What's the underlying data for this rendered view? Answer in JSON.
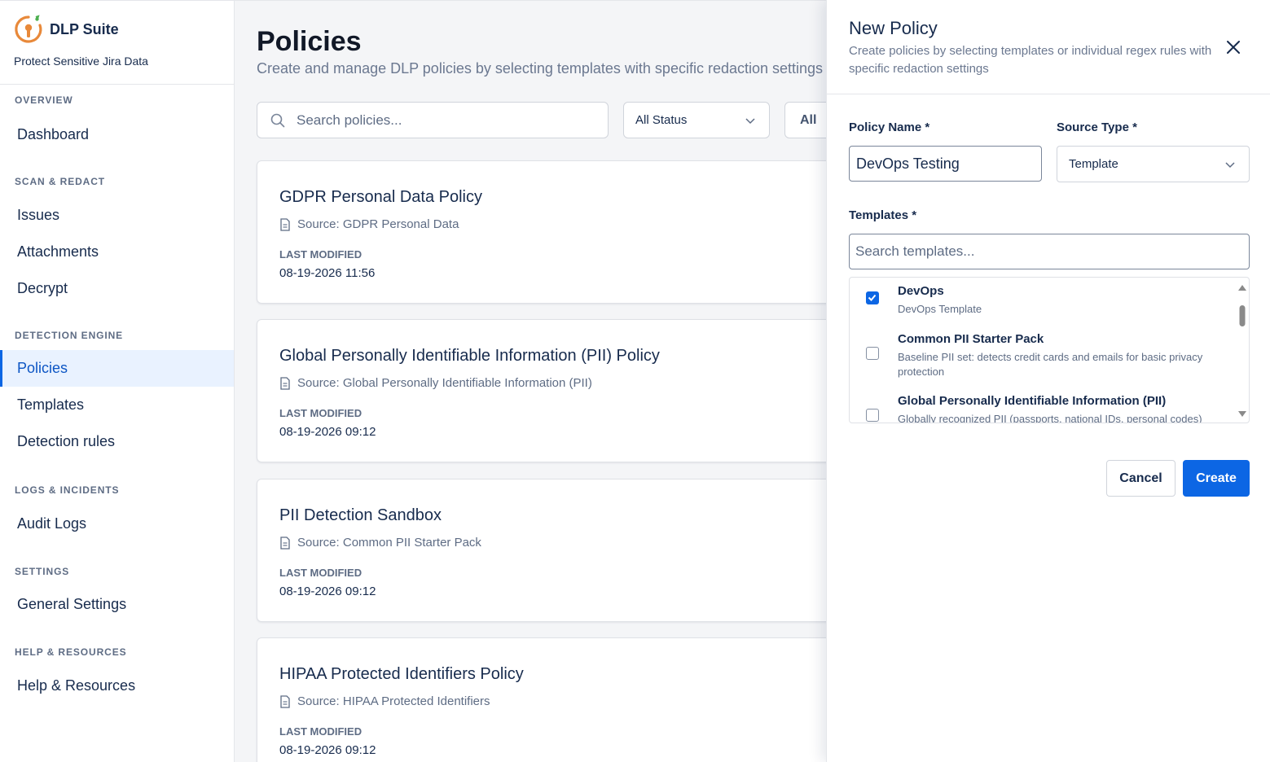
{
  "brand": {
    "name": "DLP Suite",
    "subtitle": "Protect Sensitive Jira Data",
    "logo_icon": "keyhole-logo-icon",
    "accent": "#e8893a"
  },
  "sidebar": {
    "sections": [
      {
        "title": "OVERVIEW",
        "items": [
          {
            "label": "Dashboard"
          }
        ]
      },
      {
        "title": "SCAN & REDACT",
        "items": [
          {
            "label": "Issues"
          },
          {
            "label": "Attachments"
          },
          {
            "label": "Decrypt"
          }
        ]
      },
      {
        "title": "DETECTION ENGINE",
        "items": [
          {
            "label": "Policies",
            "active": true
          },
          {
            "label": "Templates"
          },
          {
            "label": "Detection rules"
          }
        ]
      },
      {
        "title": "LOGS & INCIDENTS",
        "items": [
          {
            "label": "Audit Logs"
          }
        ]
      },
      {
        "title": "SETTINGS",
        "items": [
          {
            "label": "General Settings"
          }
        ]
      },
      {
        "title": "HELP & RESOURCES",
        "items": [
          {
            "label": "Help & Resources"
          }
        ]
      }
    ]
  },
  "main": {
    "title": "Policies",
    "subtitle": "Create and manage DLP policies by selecting templates with specific redaction settings",
    "search_placeholder": "Search policies...",
    "status_filter": "All Status",
    "second_filter": "All",
    "last_modified_label": "LAST MODIFIED",
    "policies": [
      {
        "name": "GDPR Personal Data Policy",
        "source": "Source: GDPR Personal Data",
        "date": "08-19-2026 11:56"
      },
      {
        "name": "Global Personally Identifiable Information (PII) Policy",
        "source": "Source: Global Personally Identifiable Information (PII)",
        "date": "08-19-2026 09:12"
      },
      {
        "name": "PII Detection Sandbox",
        "source": "Source: Common PII Starter Pack",
        "date": "08-19-2026 09:12"
      },
      {
        "name": "HIPAA Protected Identifiers Policy",
        "source": "Source: HIPAA Protected Identifiers",
        "date": "08-19-2026 09:12"
      }
    ]
  },
  "panel": {
    "title": "New Policy",
    "description": "Create policies by selecting templates or individual regex rules with specific redaction settings",
    "policy_name_label": "Policy Name *",
    "policy_name_value": "DevOps Testing",
    "source_type_label": "Source Type *",
    "source_type_value": "Template",
    "templates_label": "Templates *",
    "templates_search_placeholder": "Search templates...",
    "templates": [
      {
        "name": "DevOps",
        "description": "DevOps Template",
        "checked": true
      },
      {
        "name": "Common PII Starter Pack",
        "description": "Baseline PII set: detects credit cards and emails for basic privacy protection",
        "checked": false
      },
      {
        "name": "Global Personally Identifiable Information (PII)",
        "description": "Globally recognized PII (passports, national IDs, personal codes)",
        "checked": false
      }
    ],
    "cancel_label": "Cancel",
    "create_label": "Create",
    "primary_color": "#0c66e4"
  }
}
